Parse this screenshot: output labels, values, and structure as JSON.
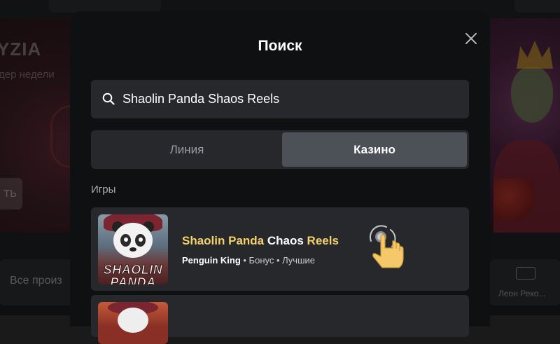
{
  "background": {
    "promo_title": "YZIA",
    "promo_subtitle": "дер недели",
    "promo_button": "ТЬ",
    "left_chip_label": "Все произ",
    "right_chip_label": "Леон Реко..."
  },
  "modal": {
    "title": "Поиск",
    "close_icon": "close-icon"
  },
  "search": {
    "value": "Shaolin Panda Shaos Reels",
    "icon": "search-icon"
  },
  "tabs": [
    {
      "label": "Линия",
      "active": false
    },
    {
      "label": "Казино",
      "active": true
    }
  ],
  "results": {
    "section_label": "Игры",
    "games": [
      {
        "title_parts": [
          "Shaolin Panda",
          " Chaos ",
          "Reels"
        ],
        "provider": "Penguin King",
        "tags": " • Бонус • Лучшие",
        "thumb_text": "SHAOLIN PANDA"
      }
    ]
  },
  "colors": {
    "modal_bg": "#0f1012",
    "field_bg": "#26282c",
    "active_tab": "#4c5057",
    "highlight": "#f6d36a",
    "tap_hand": "#f5c96a"
  }
}
